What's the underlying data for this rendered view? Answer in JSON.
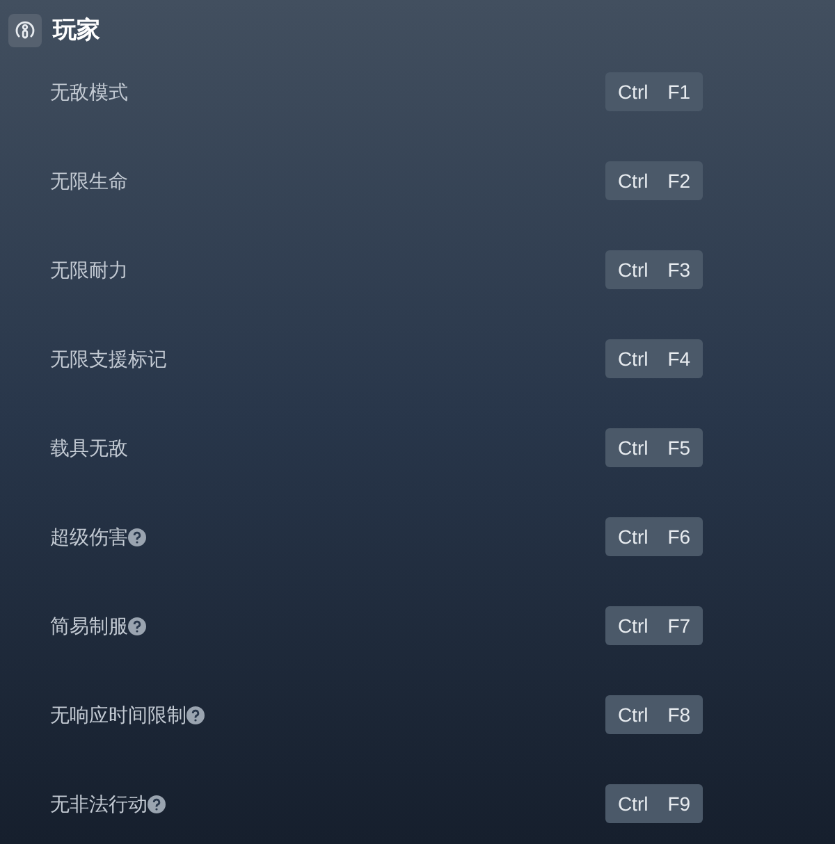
{
  "section": {
    "title": "玩家"
  },
  "cheats": [
    {
      "label": "无敌模式",
      "help": false,
      "keys": [
        "Ctrl",
        "F1"
      ]
    },
    {
      "label": "无限生命",
      "help": false,
      "keys": [
        "Ctrl",
        "F2"
      ]
    },
    {
      "label": "无限耐力",
      "help": false,
      "keys": [
        "Ctrl",
        "F3"
      ]
    },
    {
      "label": "无限支援标记",
      "help": false,
      "keys": [
        "Ctrl",
        "F4"
      ]
    },
    {
      "label": "载具无敌",
      "help": false,
      "keys": [
        "Ctrl",
        "F5"
      ]
    },
    {
      "label": "超级伤害",
      "help": true,
      "keys": [
        "Ctrl",
        "F6"
      ]
    },
    {
      "label": "简易制服",
      "help": true,
      "keys": [
        "Ctrl",
        "F7"
      ]
    },
    {
      "label": "无响应时间限制",
      "help": true,
      "keys": [
        "Ctrl",
        "F8"
      ]
    },
    {
      "label": "无非法行动",
      "help": true,
      "keys": [
        "Ctrl",
        "F9"
      ]
    }
  ]
}
